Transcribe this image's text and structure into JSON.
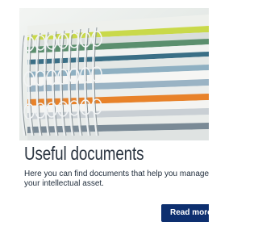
{
  "card": {
    "image_name": "stacked-spiral-notebooks-photo",
    "title": "Useful documents",
    "description": "Here you can find documents that help you manage\nyour intellectual asset.",
    "button_label": "Read more"
  },
  "colors": {
    "title_text": "#2a3440",
    "body_text": "#1e2b3a",
    "button_bg": "#0d2f6f",
    "button_text": "#ffffff"
  }
}
